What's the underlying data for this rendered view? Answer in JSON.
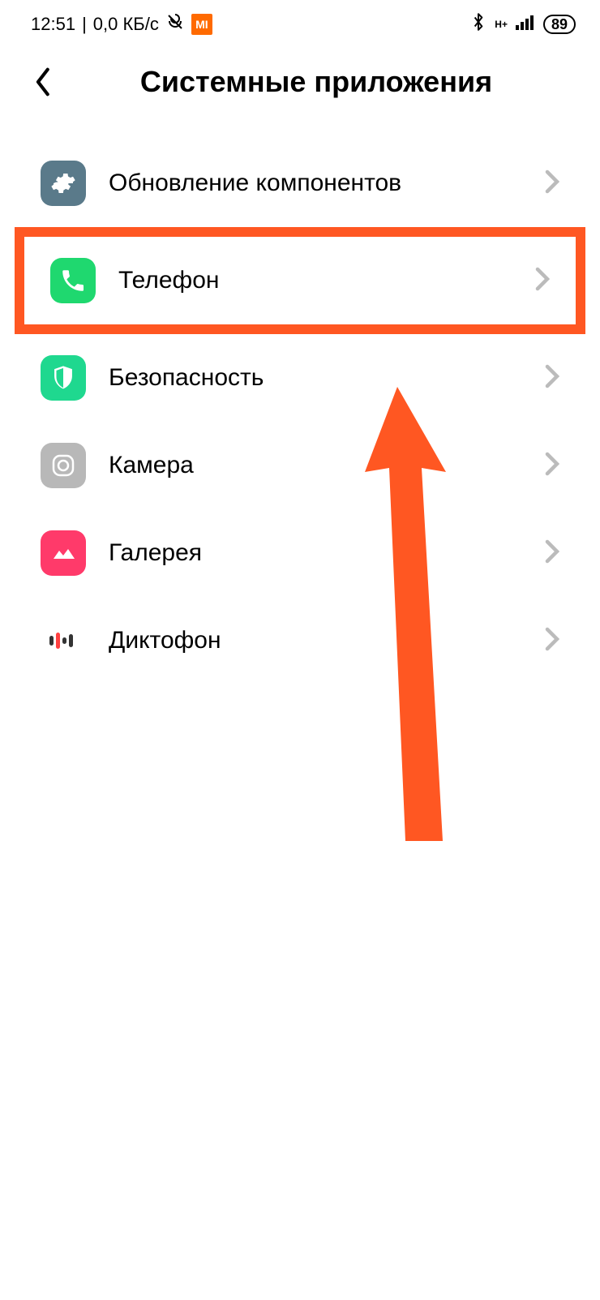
{
  "status": {
    "time": "12:51",
    "net_speed": "0,0 КБ/с",
    "battery": "89",
    "network_label": "H+"
  },
  "page": {
    "title": "Системные приложения"
  },
  "items": [
    {
      "label": "Обновление компонентов",
      "icon": "gear"
    },
    {
      "label": "Телефон",
      "icon": "phone",
      "highlighted": true
    },
    {
      "label": "Безопасность",
      "icon": "shield"
    },
    {
      "label": "Камера",
      "icon": "camera"
    },
    {
      "label": "Галерея",
      "icon": "gallery"
    },
    {
      "label": "Диктофон",
      "icon": "mic"
    }
  ]
}
